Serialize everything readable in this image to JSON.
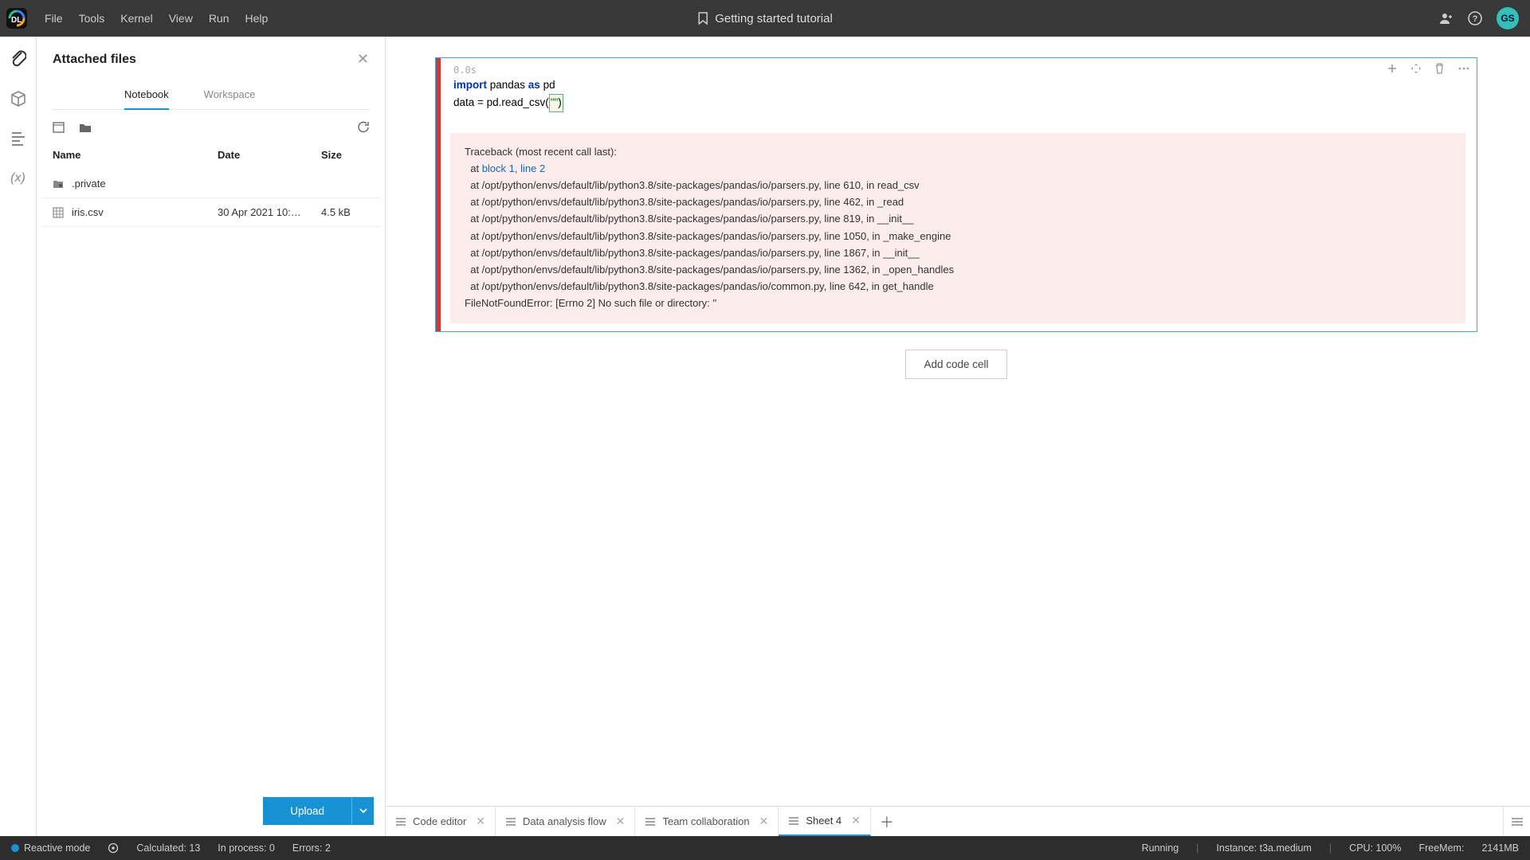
{
  "menubar": {
    "items": [
      "File",
      "Tools",
      "Kernel",
      "View",
      "Run",
      "Help"
    ]
  },
  "title": "Getting started tutorial",
  "avatar": "GS",
  "side_panel": {
    "title": "Attached files",
    "tabs": {
      "notebook": "Notebook",
      "workspace": "Workspace",
      "active": "notebook"
    },
    "columns": {
      "name": "Name",
      "date": "Date",
      "size": "Size"
    },
    "files": [
      {
        "name": ".private",
        "date": "",
        "size": ""
      },
      {
        "name": "iris.csv",
        "date": "30 Apr 2021 10:…",
        "size": "4.5 kB"
      }
    ],
    "upload_label": "Upload"
  },
  "cell": {
    "meta": "0.0s",
    "code": {
      "l1": {
        "kw": "import",
        "a": " pandas ",
        "as": "as",
        "b": " pd"
      },
      "l2": {
        "pre": "data = pd.read_csv(",
        "str": "\"\"",
        "post": ")"
      }
    },
    "traceback": {
      "head": "Traceback (most recent call last):",
      "at_prefix": "  at ",
      "link": "block 1, line 2",
      "lines": [
        "  at /opt/python/envs/default/lib/python3.8/site-packages/pandas/io/parsers.py, line 610, in read_csv",
        "  at /opt/python/envs/default/lib/python3.8/site-packages/pandas/io/parsers.py, line 462, in _read",
        "  at /opt/python/envs/default/lib/python3.8/site-packages/pandas/io/parsers.py, line 819, in __init__",
        "  at /opt/python/envs/default/lib/python3.8/site-packages/pandas/io/parsers.py, line 1050, in _make_engine",
        "  at /opt/python/envs/default/lib/python3.8/site-packages/pandas/io/parsers.py, line 1867, in __init__",
        "  at /opt/python/envs/default/lib/python3.8/site-packages/pandas/io/parsers.py, line 1362, in _open_handles",
        "  at /opt/python/envs/default/lib/python3.8/site-packages/pandas/io/common.py, line 642, in get_handle"
      ],
      "err": "FileNotFoundError: [Errno 2] No such file or directory: ''"
    }
  },
  "add_cell_label": "Add code cell",
  "bottom_tabs": [
    {
      "label": "Code editor",
      "active": false
    },
    {
      "label": "Data analysis flow",
      "active": false
    },
    {
      "label": "Team collaboration",
      "active": false
    },
    {
      "label": "Sheet 4",
      "active": true
    }
  ],
  "statusbar": {
    "mode": "Reactive mode",
    "calculated": "Calculated: 13",
    "inprocess": "In process: 0",
    "errors": "Errors: 2",
    "running": "Running",
    "instance": "Instance: t3a.medium",
    "cpu": "CPU: 100%",
    "freemem_label": "FreeMem:",
    "freemem_value": "2141MB"
  }
}
